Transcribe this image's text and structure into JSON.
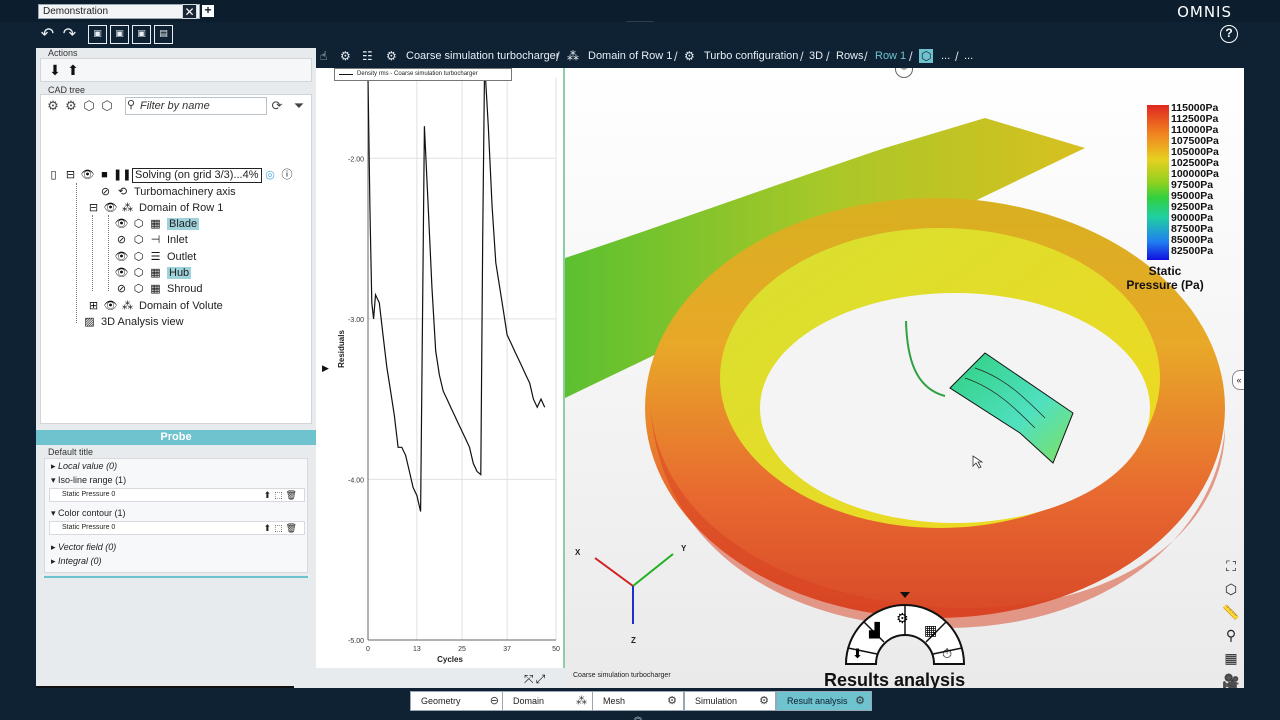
{
  "window": {
    "document_tab": "Demonstration",
    "brand": "OMNIS"
  },
  "left_panel": {
    "actions_label": "Actions",
    "cad_tree_label": "CAD tree",
    "filter_placeholder": "Filter by name",
    "tree": {
      "root": "Solving (on grid 3/3)...4%",
      "turbomachinery_axis": "Turbomachinery axis",
      "domain_row1": "Domain of Row 1",
      "blade": "Blade",
      "inlet": "Inlet",
      "outlet": "Outlet",
      "hub": "Hub",
      "shroud": "Shroud",
      "domain_volute": "Domain of Volute",
      "analysis_view": "3D Analysis view"
    }
  },
  "probe": {
    "header": "Probe",
    "default_title": "Default title",
    "local_value": "Local value (0)",
    "iso_line_range": "Iso-line range (1)",
    "iso_line_item": "Static Pressure 0",
    "color_contour": "Color contour (1)",
    "color_contour_item": "Static Pressure 0",
    "vector_field": "Vector field (0)",
    "integral": "Integral (0)"
  },
  "breadcrumb": {
    "items": [
      "Coarse simulation turbocharger",
      "Domain of Row 1",
      "Turbo configuration",
      "3D",
      "Rows",
      "Row 1",
      "...",
      "..."
    ]
  },
  "chart_data": {
    "type": "line",
    "legend": "Density rms - Coarse simulation turbocharger",
    "xlabel": "Cycles",
    "ylabel": "Residuals",
    "xlim": [
      0,
      50
    ],
    "ylim": [
      -5.0,
      -1.5
    ],
    "x_ticks": [
      "0",
      "13",
      "25",
      "37",
      "50"
    ],
    "y_ticks": [
      "-2.00",
      "-3.00",
      "-4.00",
      "-5.00"
    ],
    "series": [
      {
        "name": "Density rms - Coarse simulation turbocharger",
        "x": [
          0,
          0.5,
          1,
          1.5,
          2,
          3,
          4,
          5,
          6,
          7,
          8,
          9,
          10,
          11,
          12,
          13,
          14,
          14.5,
          15,
          16,
          17,
          18,
          19,
          20,
          21,
          22,
          23,
          24,
          25,
          26,
          27,
          28,
          29,
          30,
          30.5,
          31,
          32,
          33,
          34,
          35,
          36,
          37,
          38,
          39,
          40,
          41,
          42,
          43,
          44,
          45,
          46,
          47
        ],
        "y": [
          -1.5,
          -2.3,
          -2.9,
          -3.0,
          -2.85,
          -2.9,
          -3.1,
          -3.3,
          -3.45,
          -3.6,
          -3.8,
          -3.8,
          -3.85,
          -3.95,
          -4.05,
          -4.1,
          -4.2,
          -3.0,
          -1.8,
          -2.3,
          -2.8,
          -3.2,
          -3.35,
          -3.45,
          -3.5,
          -3.55,
          -3.6,
          -3.65,
          -3.7,
          -3.75,
          -3.8,
          -3.9,
          -3.95,
          -3.97,
          -2.5,
          -1.4,
          -1.8,
          -2.3,
          -2.65,
          -2.8,
          -2.95,
          -3.1,
          -3.15,
          -3.2,
          -3.25,
          -3.3,
          -3.35,
          -3.4,
          -3.5,
          -3.55,
          -3.5,
          -3.55
        ]
      }
    ],
    "grid": true,
    "caption": "Coarse simulation turbocharger"
  },
  "viewport": {
    "colorbar_labels": [
      "115000Pa",
      "112500Pa",
      "110000Pa",
      "107500Pa",
      "105000Pa",
      "102500Pa",
      "100000Pa",
      "97500Pa",
      "95000Pa",
      "92500Pa",
      "90000Pa",
      "87500Pa",
      "85000Pa",
      "82500Pa"
    ],
    "colorbar_title": "Static Pressure (Pa)",
    "axis_x": "X",
    "axis_y": "Y",
    "axis_z": "Z",
    "caption": "Coarse simulation turbocharger",
    "results_title": "Results analysis"
  },
  "workflow": {
    "steps": [
      "Geometry",
      "Domain",
      "Mesh",
      "Simulation",
      "Result analysis"
    ],
    "active": "Result analysis"
  }
}
